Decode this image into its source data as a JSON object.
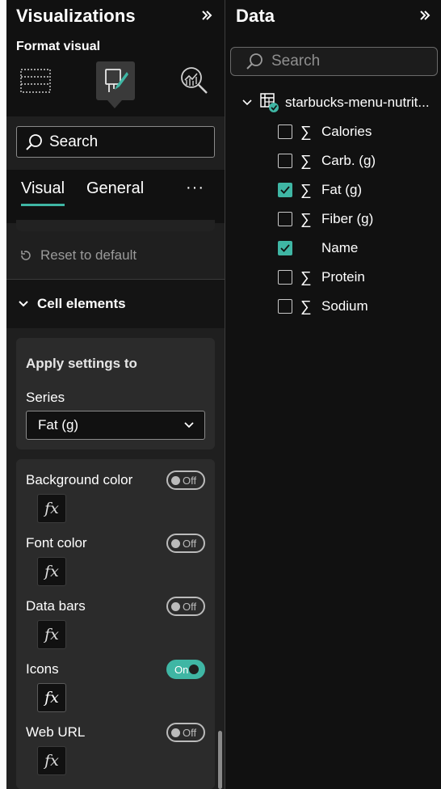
{
  "visualizations": {
    "title": "Visualizations",
    "subtitle": "Format visual",
    "search_label": "Search",
    "tabs": [
      {
        "label": "Visual",
        "active": true
      },
      {
        "label": "General",
        "active": false
      }
    ],
    "more_label": "···",
    "reset_label": "Reset to default",
    "section_title": "Cell elements",
    "apply_settings": {
      "heading": "Apply settings to",
      "series_label": "Series",
      "series_value": "Fat (g)"
    },
    "settings": [
      {
        "label": "Background color",
        "state": "Off",
        "on": false
      },
      {
        "label": "Font color",
        "state": "Off",
        "on": false
      },
      {
        "label": "Data bars",
        "state": "Off",
        "on": false
      },
      {
        "label": "Icons",
        "state": "On",
        "on": true
      },
      {
        "label": "Web URL",
        "state": "Off",
        "on": false
      }
    ],
    "fx_label": "fx"
  },
  "data": {
    "title": "Data",
    "search_placeholder": "Search",
    "table_name": "starbucks-menu-nutrit...",
    "fields": [
      {
        "name": "Calories",
        "checked": false,
        "sigma": true
      },
      {
        "name": "Carb. (g)",
        "checked": false,
        "sigma": true
      },
      {
        "name": "Fat (g)",
        "checked": true,
        "sigma": true
      },
      {
        "name": "Fiber (g)",
        "checked": false,
        "sigma": true
      },
      {
        "name": "Name",
        "checked": true,
        "sigma": false
      },
      {
        "name": "Protein",
        "checked": false,
        "sigma": true
      },
      {
        "name": "Sodium",
        "checked": false,
        "sigma": true
      }
    ],
    "sigma_symbol": "∑"
  },
  "colors": {
    "accent": "#3fb6a4",
    "pane_bg": "#1f1f1f",
    "dark_bg": "#111111",
    "card_bg": "#2b2b2b"
  }
}
